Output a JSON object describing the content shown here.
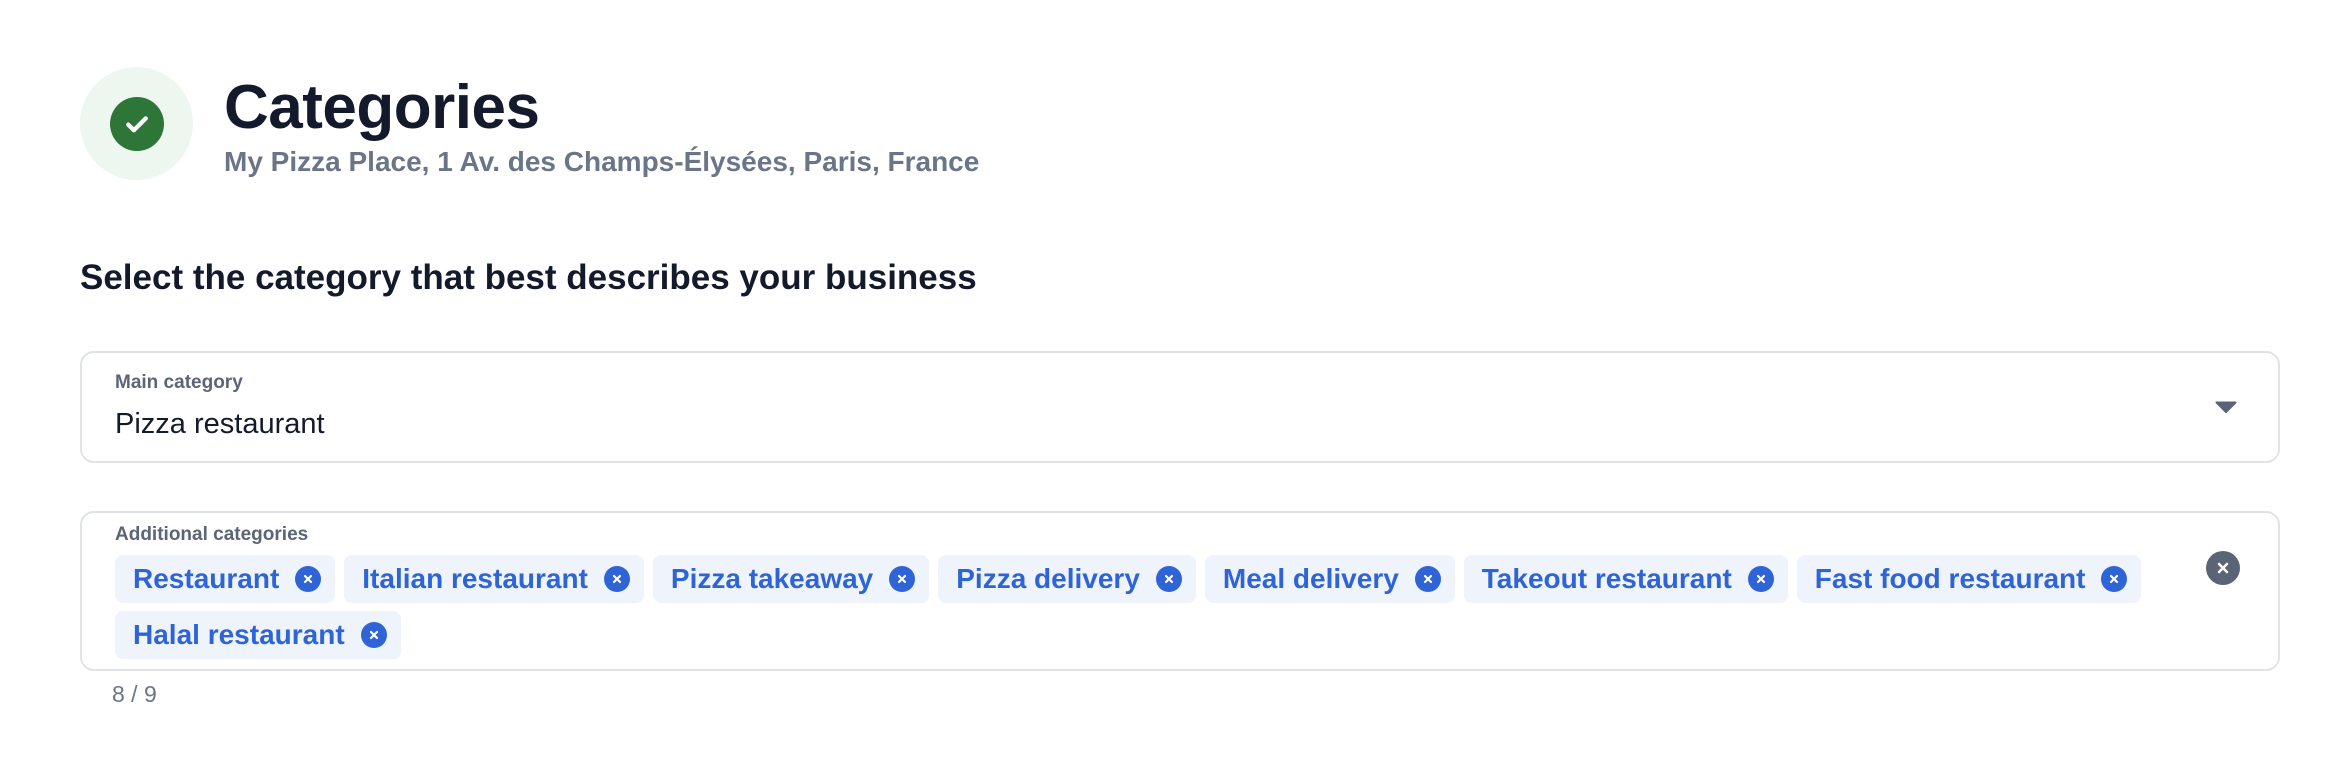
{
  "header": {
    "status_icon": "check-icon",
    "title": "Categories",
    "subtitle": "My Pizza Place, 1 Av. des Champs-Élysées, Paris, France"
  },
  "section": {
    "heading": "Select the category that best describes your business"
  },
  "main_category": {
    "label": "Main category",
    "value": "Pizza restaurant",
    "toggle_icon": "caret-down-icon"
  },
  "additional_categories": {
    "label": "Additional categories",
    "chips": [
      {
        "label": "Restaurant"
      },
      {
        "label": "Italian restaurant"
      },
      {
        "label": "Pizza takeaway"
      },
      {
        "label": "Pizza delivery"
      },
      {
        "label": "Meal delivery"
      },
      {
        "label": "Takeout restaurant"
      },
      {
        "label": "Fast food restaurant"
      },
      {
        "label": "Halal restaurant"
      }
    ],
    "clear_icon": "clear-all-icon",
    "counter": "8 / 9"
  },
  "colors": {
    "accent": "#2f64d6",
    "chip_background": "#eef3fc",
    "success": "#2e7538",
    "success_background": "#eef6f0",
    "muted_text": "#6b7588"
  }
}
